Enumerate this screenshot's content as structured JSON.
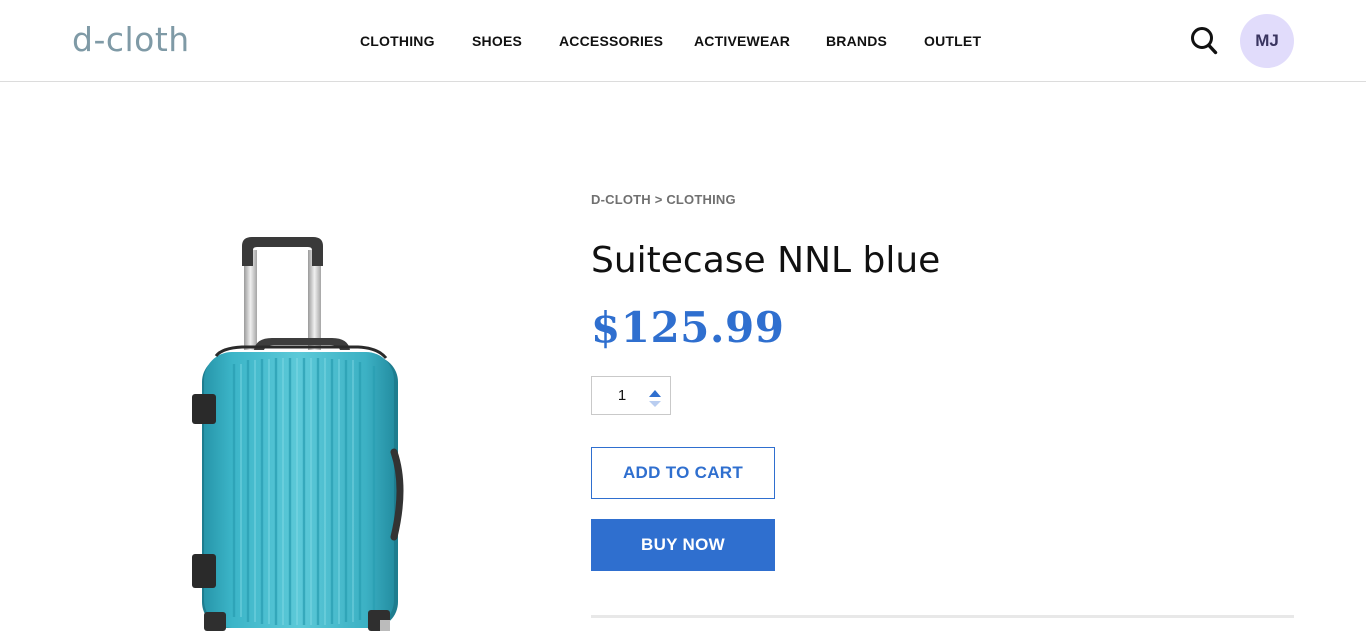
{
  "header": {
    "logo": "d-cloth",
    "nav": [
      {
        "label": "CLOTHING"
      },
      {
        "label": "SHOES"
      },
      {
        "label": "ACCESSORIES"
      },
      {
        "label": "ACTIVEWEAR"
      },
      {
        "label": "BRANDS"
      },
      {
        "label": "OUTLET"
      }
    ],
    "search_icon": "search-icon",
    "avatar_initials": "MJ"
  },
  "product": {
    "breadcrumb": {
      "root": "D-CLOTH",
      "separator": ">",
      "category": "CLOTHING"
    },
    "title": "Suitecase NNL blue",
    "price": "$125.99",
    "quantity": "1",
    "image_icon": "suitcase-image",
    "add_to_cart_label": "ADD TO CART",
    "buy_now_label": "BUY NOW"
  },
  "colors": {
    "accent": "#2f6fcf",
    "logo": "#7f9aa6",
    "avatar_bg": "#e1dcfb",
    "suitcase": "#3ab6c9"
  }
}
